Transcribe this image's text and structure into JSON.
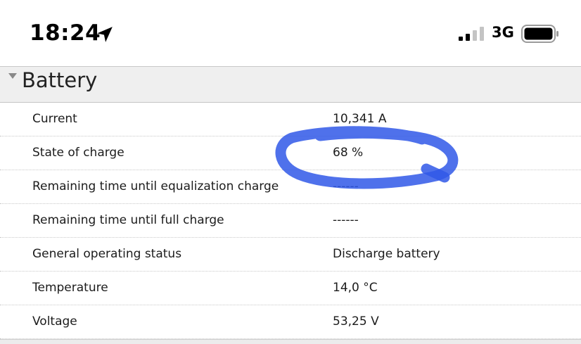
{
  "status_bar": {
    "time": "18:24",
    "network": "3G",
    "icons": [
      "location-arrow-icon",
      "signal-strength-icon",
      "battery-icon"
    ]
  },
  "section": {
    "title": "Battery",
    "icon": "collapse-triangle-icon"
  },
  "rows": [
    {
      "label": "Current",
      "value": "10,341 A"
    },
    {
      "label": "State of charge",
      "value": "68 %"
    },
    {
      "label": "Remaining time until equalization charge",
      "value": "------"
    },
    {
      "label": "Remaining time until full charge",
      "value": "------"
    },
    {
      "label": "General operating status",
      "value": "Discharge battery"
    },
    {
      "label": "Temperature",
      "value": "14,0 °C"
    },
    {
      "label": "Voltage",
      "value": "53,25 V"
    }
  ],
  "annotation": {
    "color": "#2f5bea",
    "target": "State of charge"
  }
}
